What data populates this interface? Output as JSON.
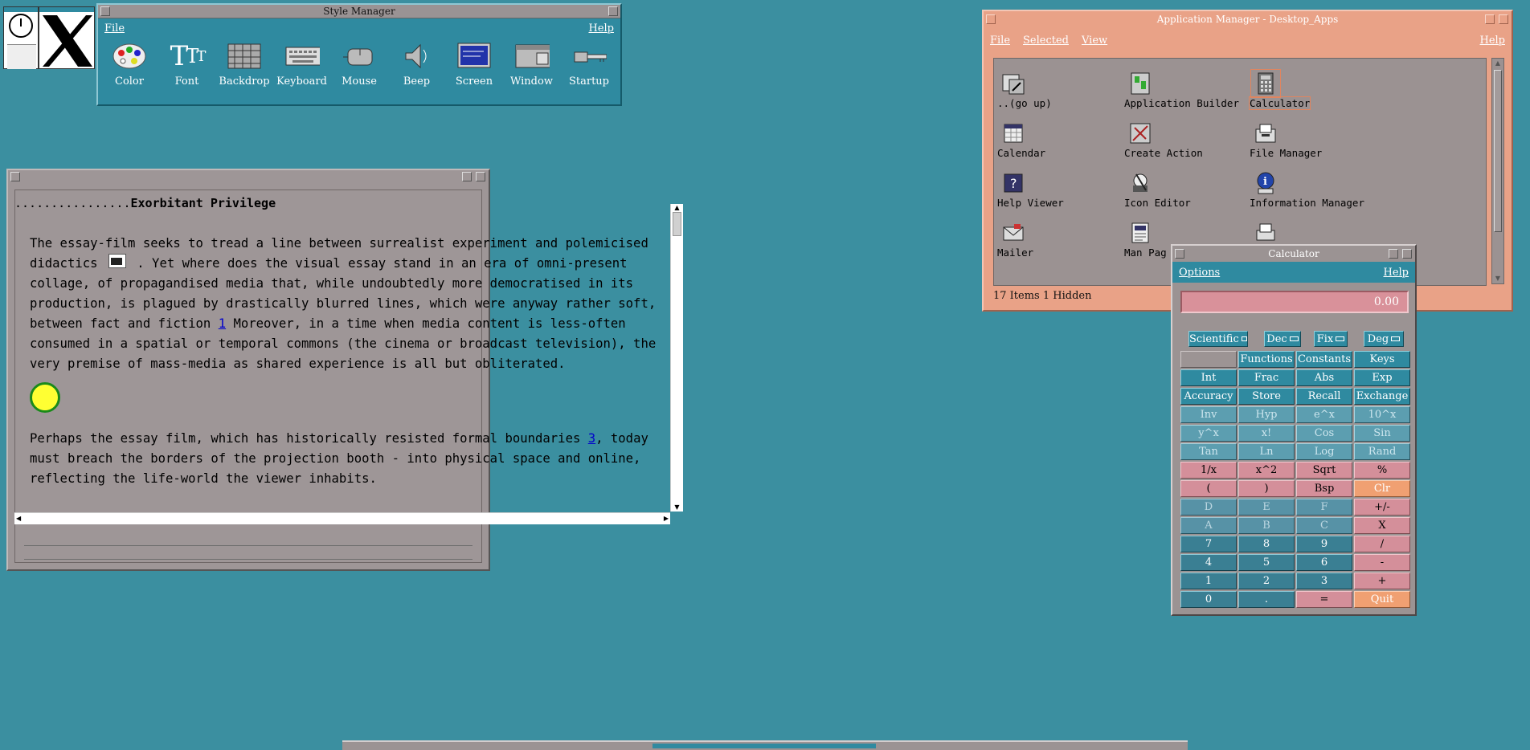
{
  "desktop": {
    "background": "#3b8fa0"
  },
  "style_manager": {
    "title": "Style Manager",
    "menu": {
      "file": "File",
      "help": "Help"
    },
    "tools": [
      "Color",
      "Font",
      "Backdrop",
      "Keyboard",
      "Mouse",
      "Beep",
      "Screen",
      "Window",
      "Startup"
    ]
  },
  "document": {
    "heading_dots": "................",
    "heading": "Exorbitant Privilege",
    "p1_a": "The essay-film seeks to tread a line between surrealist experiment and polemicised didactics",
    "p1_b": ". Yet where does the visual essay stand in an era of omni-present collage, of propagandised media that, while undoubtedly more democratised in its production, is plagued by drastically blurred lines, which were anyway rather soft, between fact and fiction",
    "link1": "1",
    "p1_c": "Moreover, in a time when media content is less-often consumed in a spatial or temporal commons (the cinema or broadcast television), the very premise of mass-media as shared experience is all but obliterated.",
    "p2_a": "Perhaps the essay film, which has historically resisted formal boundaries",
    "link3": "3",
    "p2_b": ", today must breach the borders of the projection booth - into physical space and online, reflecting the life-world the viewer inhabits."
  },
  "app_manager": {
    "title": "Application Manager - Desktop_Apps",
    "menu": {
      "file": "File",
      "selected": "Selected",
      "view": "View",
      "help": "Help"
    },
    "items": [
      {
        "label": "..(go up)",
        "icon": "folder-up-icon"
      },
      {
        "label": "Application Builder",
        "icon": "app-builder-icon"
      },
      {
        "label": "Calculator",
        "icon": "calculator-icon"
      },
      {
        "label": "Calendar",
        "icon": "calendar-icon"
      },
      {
        "label": "Create Action",
        "icon": "create-action-icon"
      },
      {
        "label": "File Manager",
        "icon": "file-manager-icon"
      },
      {
        "label": "Help Viewer",
        "icon": "help-viewer-icon"
      },
      {
        "label": "Icon Editor",
        "icon": "icon-editor-icon"
      },
      {
        "label": "Information Manager",
        "icon": "info-manager-icon"
      },
      {
        "label": "Mailer",
        "icon": "mailer-icon"
      },
      {
        "label": "Man Pag",
        "icon": "man-page-icon"
      }
    ],
    "status": "17 Items 1 Hidden"
  },
  "calculator": {
    "title": "Calculator",
    "menu": {
      "options": "Options",
      "help": "Help"
    },
    "display": "0.00",
    "modes": [
      "Scientific",
      "Dec",
      "Fix",
      "Deg"
    ],
    "keys": [
      {
        "label": "",
        "style": "grey"
      },
      {
        "label": "Functions",
        "style": "teal"
      },
      {
        "label": "Constants",
        "style": "teal"
      },
      {
        "label": "Keys",
        "style": "teal"
      },
      {
        "label": "Int",
        "style": "teal"
      },
      {
        "label": "Frac",
        "style": "teal"
      },
      {
        "label": "Abs",
        "style": "teal"
      },
      {
        "label": "Exp",
        "style": "teal"
      },
      {
        "label": "Accuracy",
        "style": "teal"
      },
      {
        "label": "Store",
        "style": "teal"
      },
      {
        "label": "Recall",
        "style": "teal"
      },
      {
        "label": "Exchange",
        "style": "teal"
      },
      {
        "label": "Inv",
        "style": "lt"
      },
      {
        "label": "Hyp",
        "style": "lt"
      },
      {
        "label": "e^x",
        "style": "lt"
      },
      {
        "label": "10^x",
        "style": "lt"
      },
      {
        "label": "y^x",
        "style": "lt"
      },
      {
        "label": "x!",
        "style": "lt"
      },
      {
        "label": "Cos",
        "style": "lt"
      },
      {
        "label": "Sin",
        "style": "lt"
      },
      {
        "label": "Tan",
        "style": "lt"
      },
      {
        "label": "Ln",
        "style": "lt"
      },
      {
        "label": "Log",
        "style": "lt"
      },
      {
        "label": "Rand",
        "style": "lt"
      },
      {
        "label": "1/x",
        "style": "pink"
      },
      {
        "label": "x^2",
        "style": "pink"
      },
      {
        "label": "Sqrt",
        "style": "pink"
      },
      {
        "label": "%",
        "style": "pink"
      },
      {
        "label": "(",
        "style": "pink"
      },
      {
        "label": ")",
        "style": "pink"
      },
      {
        "label": "Bsp",
        "style": "pink"
      },
      {
        "label": "Clr",
        "style": "orange"
      },
      {
        "label": "D",
        "style": "blue"
      },
      {
        "label": "E",
        "style": "blue"
      },
      {
        "label": "F",
        "style": "blue"
      },
      {
        "label": "+/-",
        "style": "pink"
      },
      {
        "label": "A",
        "style": "blue"
      },
      {
        "label": "B",
        "style": "blue"
      },
      {
        "label": "C",
        "style": "blue"
      },
      {
        "label": "X",
        "style": "pink"
      },
      {
        "label": "7",
        "style": "dk"
      },
      {
        "label": "8",
        "style": "dk"
      },
      {
        "label": "9",
        "style": "dk"
      },
      {
        "label": "/",
        "style": "pink"
      },
      {
        "label": "4",
        "style": "dk"
      },
      {
        "label": "5",
        "style": "dk"
      },
      {
        "label": "6",
        "style": "dk"
      },
      {
        "label": "-",
        "style": "pink"
      },
      {
        "label": "1",
        "style": "dk"
      },
      {
        "label": "2",
        "style": "dk"
      },
      {
        "label": "3",
        "style": "dk"
      },
      {
        "label": "+",
        "style": "pink"
      },
      {
        "label": "0",
        "style": "dk"
      },
      {
        "label": ".",
        "style": "dk"
      },
      {
        "label": "=",
        "style": "pink"
      },
      {
        "label": "Quit",
        "style": "orange"
      }
    ]
  }
}
